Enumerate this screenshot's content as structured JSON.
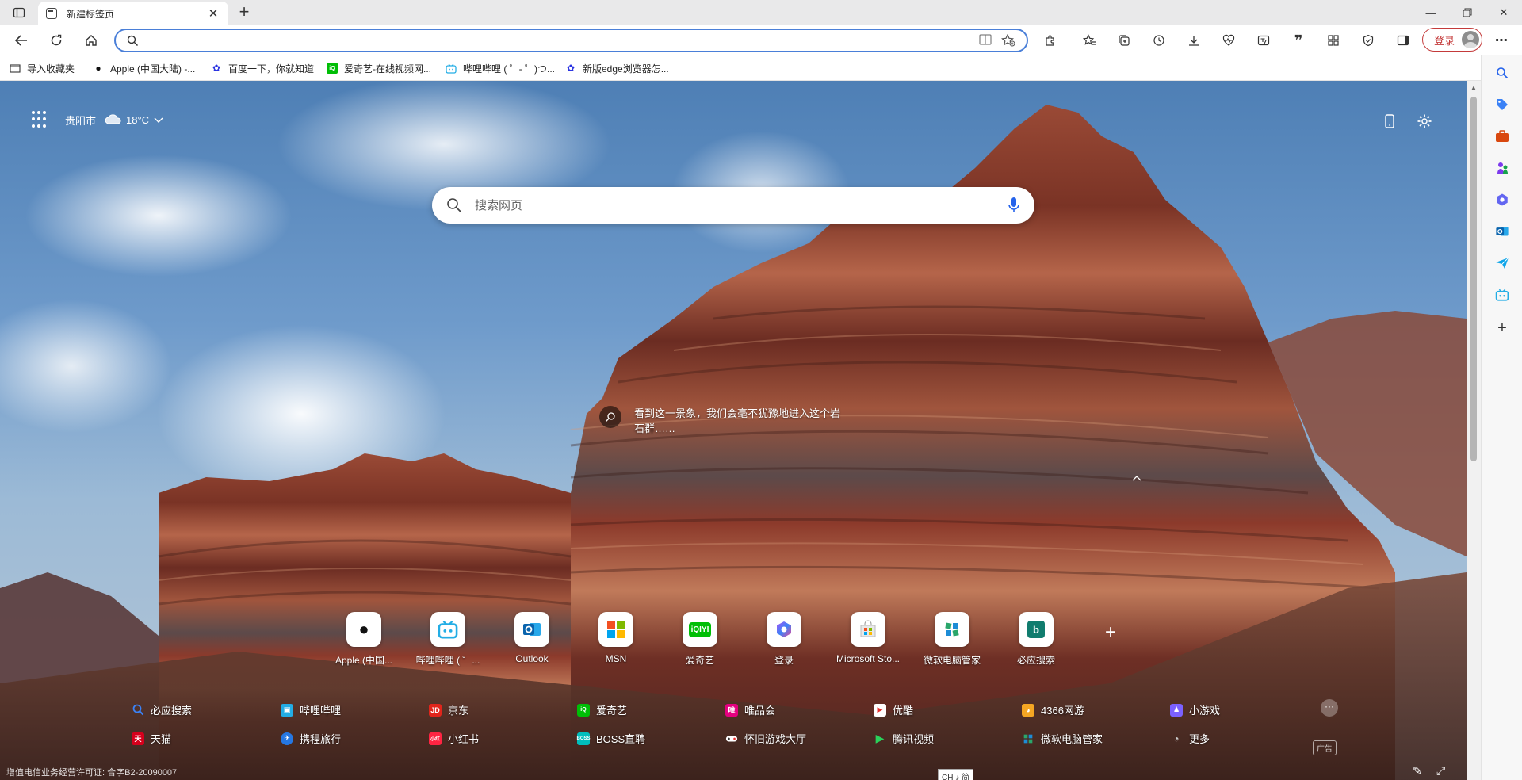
{
  "tab": {
    "title": "新建标签页"
  },
  "address_bar": {
    "value": "",
    "placeholder": ""
  },
  "toolbar": {
    "login_label": "登录"
  },
  "favorites": [
    {
      "label": "导入收藏夹",
      "icon": "import-icon"
    },
    {
      "label": "Apple (中国大陆) -...",
      "icon": "apple-icon"
    },
    {
      "label": "百度一下，你就知道",
      "icon": "baidu-icon"
    },
    {
      "label": "爱奇艺-在线视频网...",
      "icon": "iqiyi-icon"
    },
    {
      "label": "哔哩哔哩 ( ゜- ゜)つ...",
      "icon": "bilibili-icon"
    },
    {
      "label": "新版edge浏览器怎...",
      "icon": "baidu-icon"
    }
  ],
  "weather": {
    "city": "贵阳市",
    "temp": "18°C"
  },
  "search": {
    "placeholder": "搜索网页"
  },
  "caption": {
    "text": "看到这一景象，我们会毫不犹豫地进入这个岩石群……"
  },
  "quick_links": [
    {
      "label": "Apple (中国...",
      "icon": "apple-icon"
    },
    {
      "label": "哔哩哔哩 ( ゜...",
      "icon": "bilibili-icon"
    },
    {
      "label": "Outlook",
      "icon": "outlook-icon"
    },
    {
      "label": "MSN",
      "icon": "msn-icon"
    },
    {
      "label": "爱奇艺",
      "icon": "iqiyi-icon"
    },
    {
      "label": "登录",
      "icon": "m365-icon"
    },
    {
      "label": "Microsoft Sto...",
      "icon": "store-icon"
    },
    {
      "label": "微软电脑管家",
      "icon": "pc-manager-icon"
    },
    {
      "label": "必应搜索",
      "icon": "bing-icon"
    }
  ],
  "site_links_row1": [
    {
      "label": "必应搜索",
      "icon": "search-icon",
      "color": "#3b82f6"
    },
    {
      "label": "哔哩哔哩",
      "icon": "bilibili-icon",
      "color": "#23ade5"
    },
    {
      "label": "京东",
      "icon": "jd-icon",
      "color": "#e1251b"
    },
    {
      "label": "爱奇艺",
      "icon": "iqiyi-icon",
      "color": "#00be06"
    },
    {
      "label": "唯品会",
      "icon": "vip-icon",
      "color": "#e4007f"
    },
    {
      "label": "优酷",
      "icon": "youku-icon",
      "color": "#2b8cff"
    },
    {
      "label": "4366网游",
      "icon": "4366-icon",
      "color": "#f5a623"
    },
    {
      "label": "小游戏",
      "icon": "game-icon",
      "color": "#7b61ff"
    }
  ],
  "site_links_row2": [
    {
      "label": "天猫",
      "icon": "tmall-icon",
      "color": "#d6001c"
    },
    {
      "label": "携程旅行",
      "icon": "ctrip-icon",
      "color": "#2577e3"
    },
    {
      "label": "小红书",
      "icon": "xhs-icon",
      "color": "#ff2442"
    },
    {
      "label": "BOSS直聘",
      "icon": "boss-icon",
      "color": "#00bebd"
    },
    {
      "label": "怀旧游戏大厅",
      "icon": "retro-game-icon",
      "color": "#ffffff"
    },
    {
      "label": "腾讯视频",
      "icon": "tencent-video-icon",
      "color": "#2ad25b"
    },
    {
      "label": "微软电脑管家",
      "icon": "pc-manager-icon",
      "color": "#38b16a"
    },
    {
      "label": "更多",
      "icon": "more-icon",
      "color": "#888888"
    }
  ],
  "ad_label": "广告",
  "license": "增值电信业务经营许可证: 合字B2-20090007",
  "ime_label": "CH ♪ 简"
}
